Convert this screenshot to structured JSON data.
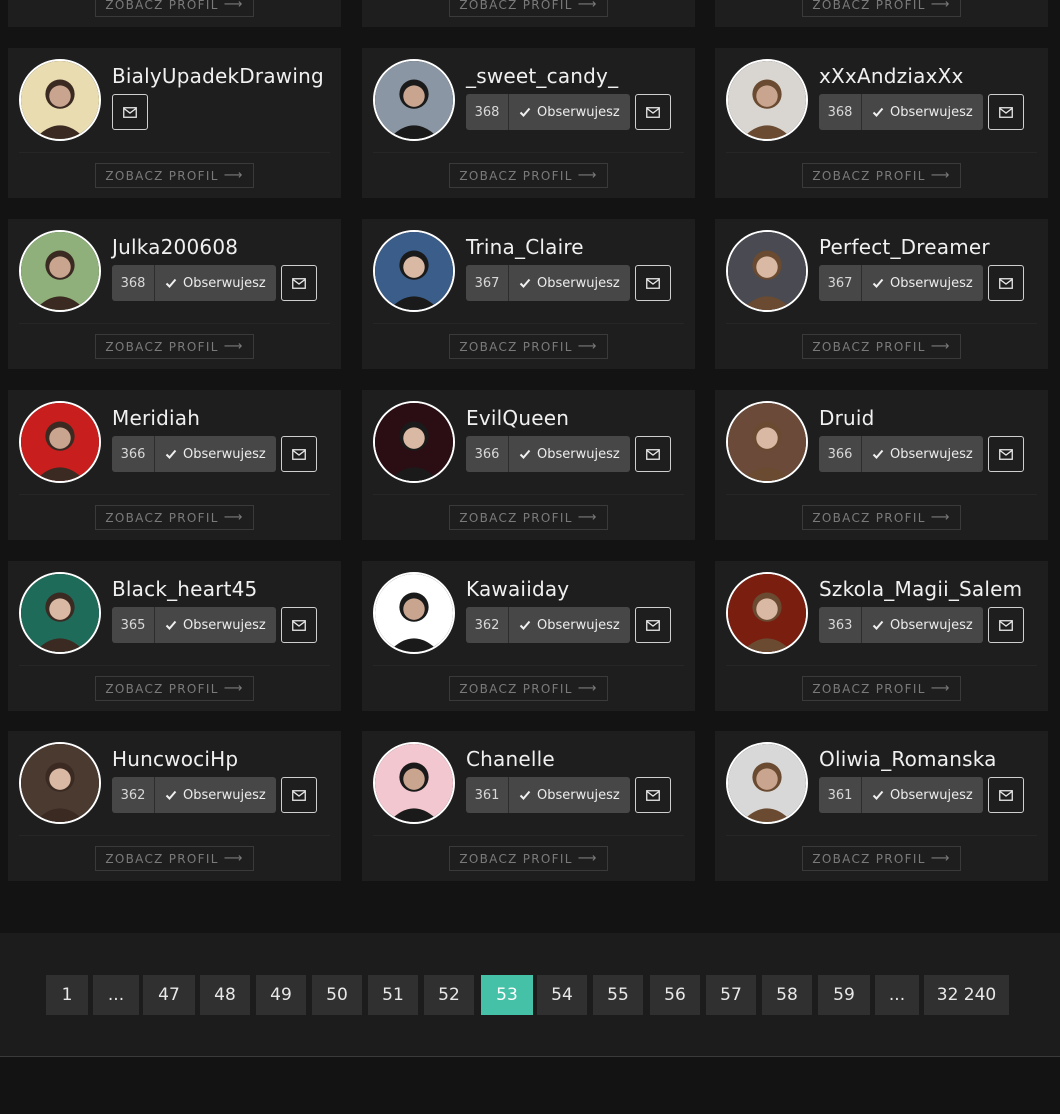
{
  "profiles": [
    {
      "username": "BialyUpadekDrawing",
      "followers": "",
      "follow_label": "",
      "followed": false
    },
    {
      "username": "_sweet_candy_",
      "followers": "368",
      "follow_label": "Obserwujesz",
      "followed": true
    },
    {
      "username": "xXxAndziaxXx",
      "followers": "368",
      "follow_label": "Obserwujesz",
      "followed": true
    },
    {
      "username": "Julka200608",
      "followers": "368",
      "follow_label": "Obserwujesz",
      "followed": true
    },
    {
      "username": "Trina_Claire",
      "followers": "367",
      "follow_label": "Obserwujesz",
      "followed": true
    },
    {
      "username": "Perfect_Dreamer",
      "followers": "367",
      "follow_label": "Obserwujesz",
      "followed": true
    },
    {
      "username": "Meridiah",
      "followers": "366",
      "follow_label": "Obserwujesz",
      "followed": true
    },
    {
      "username": "EvilQueen",
      "followers": "366",
      "follow_label": "Obserwujesz",
      "followed": true
    },
    {
      "username": "Druid",
      "followers": "366",
      "follow_label": "Obserwujesz",
      "followed": true
    },
    {
      "username": "Black_heart45",
      "followers": "365",
      "follow_label": "Obserwujesz",
      "followed": true
    },
    {
      "username": "Kawaiiday",
      "followers": "362",
      "follow_label": "Obserwujesz",
      "followed": true
    },
    {
      "username": "Szkola_Magii_Salem",
      "followers": "363",
      "follow_label": "Obserwujesz",
      "followed": true
    },
    {
      "username": "HuncwociHp",
      "followers": "362",
      "follow_label": "Obserwujesz",
      "followed": true
    },
    {
      "username": "Chanelle",
      "followers": "361",
      "follow_label": "Obserwujesz",
      "followed": true
    },
    {
      "username": "Oliwia_Romanska",
      "followers": "361",
      "follow_label": "Obserwujesz",
      "followed": true
    }
  ],
  "profile_button_label": "ZOBACZ PROFIL",
  "avatar_colors": [
    "#e8dcb0",
    "#8a96a4",
    "#d9d6d2",
    "#8fb07a",
    "#3b5d8a",
    "#4a4a52",
    "#c81e1e",
    "#2a0e14",
    "#6b4a3a",
    "#1f6b5a",
    "#ffffff",
    "#7a1e10",
    "#4a3a30",
    "#f3c7cf",
    "#d8d8d8"
  ],
  "pagination": {
    "pages": [
      "1",
      "...",
      "47",
      "48",
      "49",
      "50",
      "51",
      "52",
      "53",
      "54",
      "55",
      "56",
      "57",
      "58",
      "59",
      "...",
      "32 240"
    ],
    "current": "53",
    "active_color": "#44c1a6"
  }
}
